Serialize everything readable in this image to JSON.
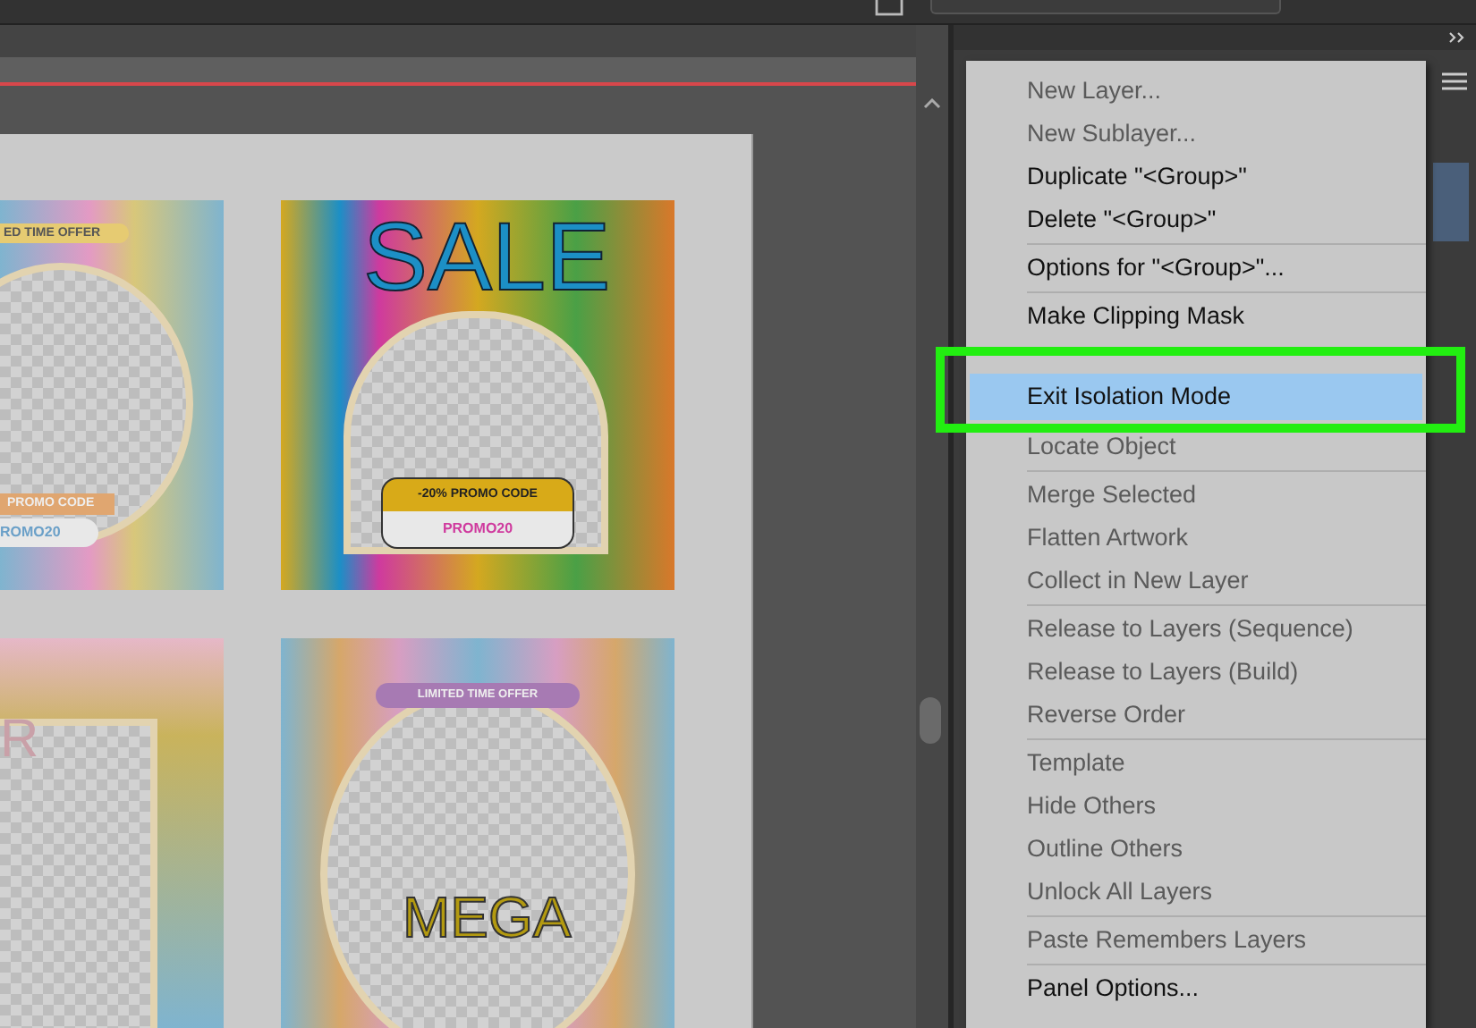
{
  "artboard": {
    "cards": [
      {
        "kind": "waves",
        "texts": [
          {
            "kind": "banner",
            "text": "ED TIME OFFER"
          },
          {
            "kind": "code_label",
            "text": "PROMO CODE"
          },
          {
            "kind": "code",
            "text": "ROMO20"
          }
        ]
      },
      {
        "kind": "sale",
        "texts": [
          {
            "kind": "headline",
            "text": "SALE"
          },
          {
            "kind": "code_label",
            "text": "-20% PROMO CODE"
          },
          {
            "kind": "code",
            "text": "PROMO20"
          }
        ]
      },
      {
        "kind": "flowers",
        "texts": [
          {
            "kind": "headline",
            "text": "R"
          }
        ]
      },
      {
        "kind": "ornate",
        "texts": [
          {
            "kind": "banner",
            "text": "LIMITED TIME OFFER"
          },
          {
            "kind": "headline",
            "text": "MEGA"
          }
        ]
      }
    ]
  },
  "panel_menu": {
    "items": [
      {
        "kind": "item",
        "label": "New Layer...",
        "disabled": true,
        "selected": false
      },
      {
        "kind": "item",
        "label": "New Sublayer...",
        "disabled": true,
        "selected": false
      },
      {
        "kind": "item",
        "label": "Duplicate \"<Group>\"",
        "disabled": false,
        "selected": false
      },
      {
        "kind": "item",
        "label": "Delete \"<Group>\"",
        "disabled": false,
        "selected": false
      },
      {
        "kind": "separator"
      },
      {
        "kind": "item",
        "label": "Options for \"<Group>\"...",
        "disabled": false,
        "selected": false
      },
      {
        "kind": "separator"
      },
      {
        "kind": "item",
        "label": "Make Clipping Mask",
        "disabled": false,
        "selected": false
      },
      {
        "kind": "hidden"
      },
      {
        "kind": "item",
        "label": "Exit Isolation Mode",
        "disabled": false,
        "selected": true
      },
      {
        "kind": "item",
        "label": "Locate Object",
        "disabled": true,
        "selected": false
      },
      {
        "kind": "separator"
      },
      {
        "kind": "item",
        "label": "Merge Selected",
        "disabled": true,
        "selected": false
      },
      {
        "kind": "item",
        "label": "Flatten Artwork",
        "disabled": true,
        "selected": false
      },
      {
        "kind": "item",
        "label": "Collect in New Layer",
        "disabled": true,
        "selected": false
      },
      {
        "kind": "separator"
      },
      {
        "kind": "item",
        "label": "Release to Layers (Sequence)",
        "disabled": true,
        "selected": false
      },
      {
        "kind": "item",
        "label": "Release to Layers (Build)",
        "disabled": true,
        "selected": false
      },
      {
        "kind": "item",
        "label": "Reverse Order",
        "disabled": true,
        "selected": false
      },
      {
        "kind": "separator"
      },
      {
        "kind": "item",
        "label": "Template",
        "disabled": true,
        "selected": false
      },
      {
        "kind": "item",
        "label": "Hide Others",
        "disabled": true,
        "selected": false
      },
      {
        "kind": "item",
        "label": "Outline Others",
        "disabled": true,
        "selected": false
      },
      {
        "kind": "item",
        "label": "Unlock All Layers",
        "disabled": true,
        "selected": false
      },
      {
        "kind": "separator"
      },
      {
        "kind": "item",
        "label": "Paste Remembers Layers",
        "disabled": true,
        "selected": false
      },
      {
        "kind": "separator"
      },
      {
        "kind": "item",
        "label": "Panel Options...",
        "disabled": false,
        "selected": false
      }
    ]
  }
}
